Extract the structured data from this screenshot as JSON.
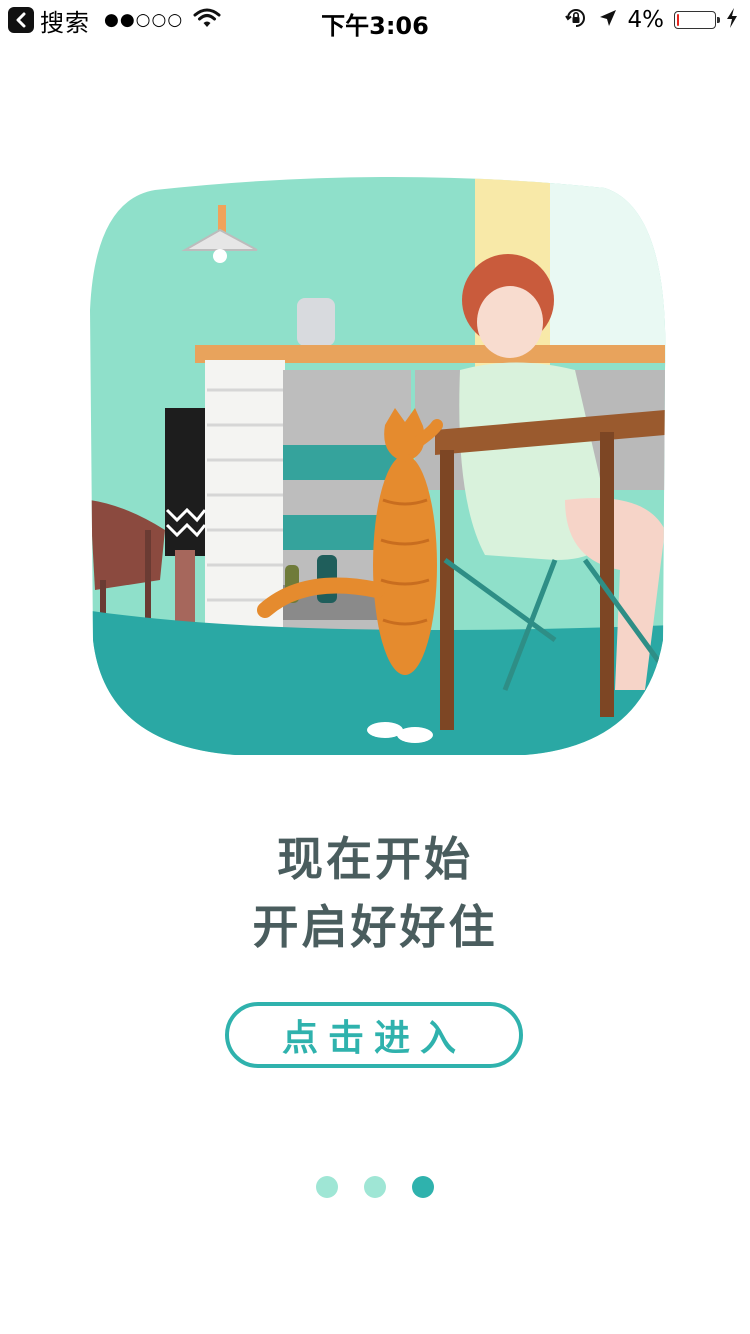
{
  "status_bar": {
    "back_app": "搜索",
    "signal": "●●○○○",
    "time": "下午3:06",
    "battery_percent": "4%",
    "battery_level": 0.04,
    "icons": [
      "back-chevron-icon",
      "wifi-icon",
      "orientation-lock-icon",
      "location-arrow-icon",
      "battery-icon",
      "charging-bolt-icon"
    ]
  },
  "illustration": {
    "icon": "illustration-woman-with-cat-kitchen"
  },
  "headline": {
    "line1": "现在开始",
    "line2": "开启好好住"
  },
  "enter_button": {
    "label": "点击进入"
  },
  "pagination": {
    "count": 3,
    "active_index": 2,
    "colors": {
      "inactive": "#9fe6d5",
      "active": "#2fb2ad"
    }
  },
  "colors": {
    "accent": "#2fb2ad",
    "headline": "#4a5d5e",
    "background": "#ffffff"
  }
}
